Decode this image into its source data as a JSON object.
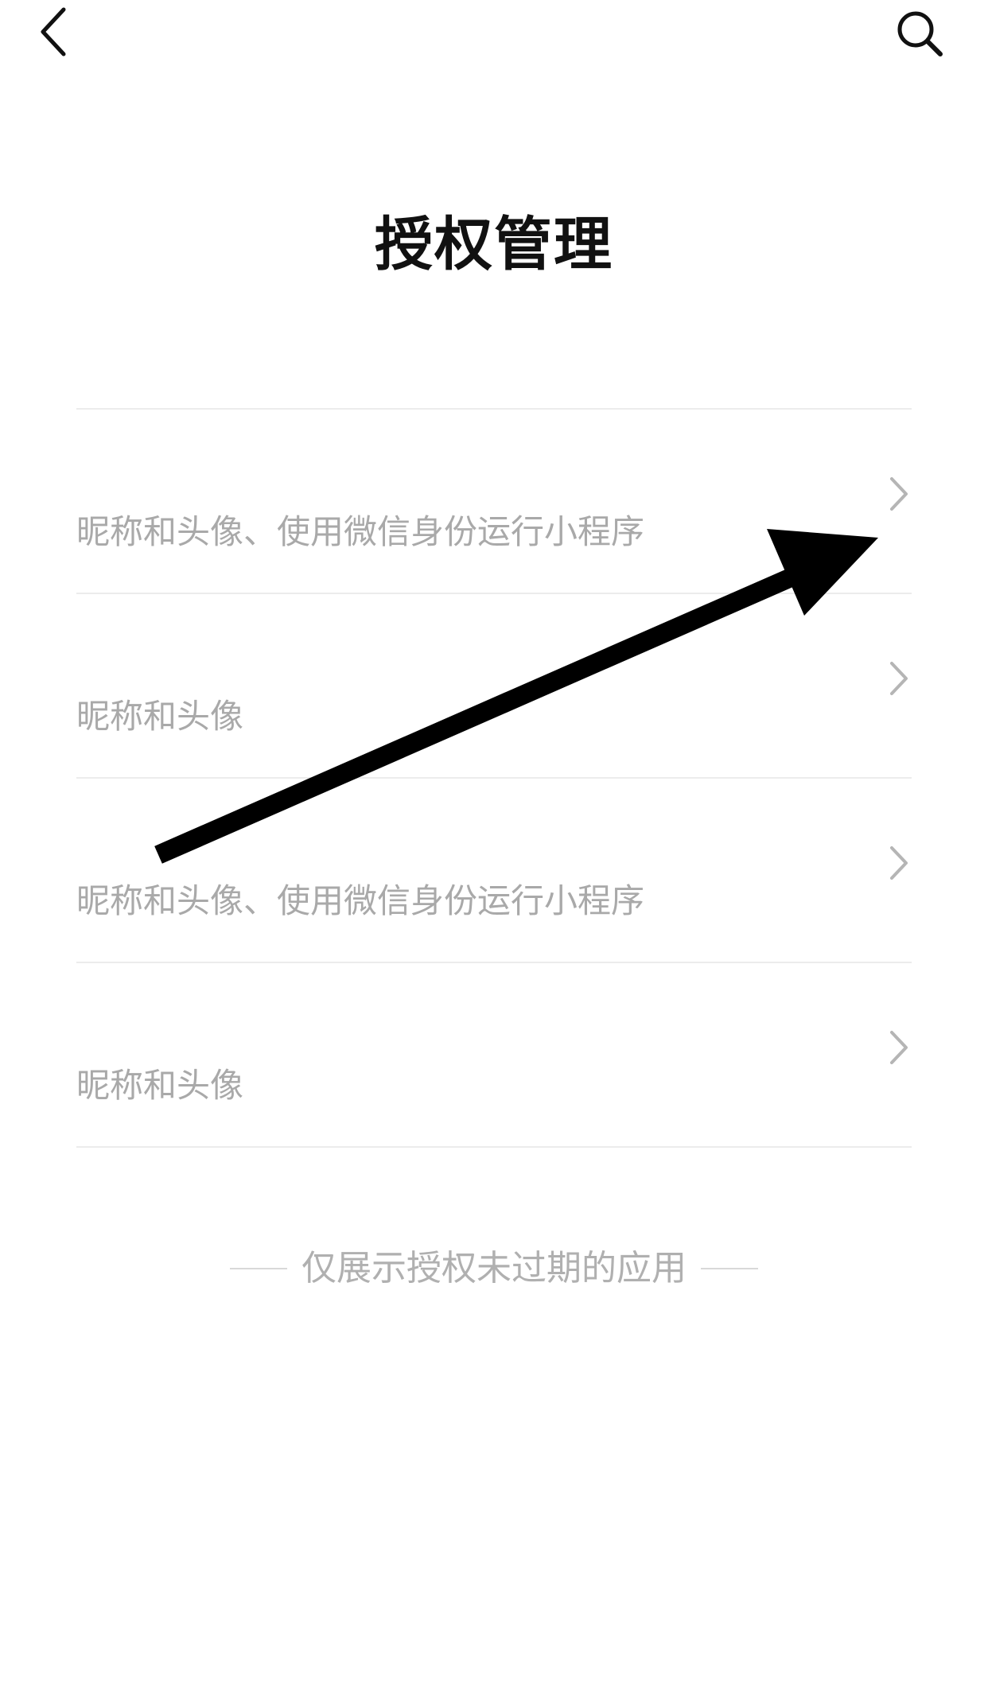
{
  "header": {
    "title": "授权管理",
    "back_icon": "chevron-left-icon",
    "search_icon": "search-icon"
  },
  "auth_list": {
    "items": [
      {
        "name": "",
        "description": "昵称和头像、使用微信身份运行小程序"
      },
      {
        "name": "",
        "description": "昵称和头像"
      },
      {
        "name": "",
        "description": "昵称和头像、使用微信身份运行小程序"
      },
      {
        "name": "",
        "description": "昵称和头像"
      }
    ]
  },
  "footer": {
    "note": "仅展示授权未过期的应用"
  },
  "colors": {
    "background": "#ffffff",
    "title": "#111111",
    "secondary_text": "#a9a9a9",
    "divider": "#ececec",
    "chevron": "#b5b5b5",
    "annotation_arrow": "#000000"
  }
}
